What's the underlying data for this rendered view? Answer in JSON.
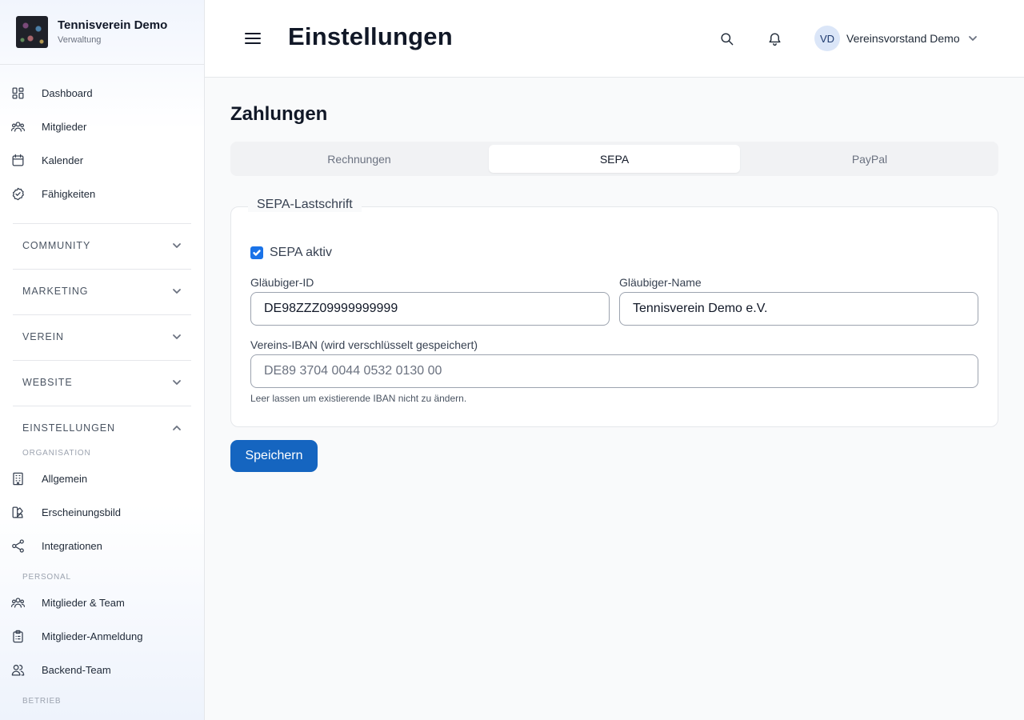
{
  "brand": {
    "name": "Tennisverein Demo",
    "subtitle": "Verwaltung"
  },
  "sidebar": {
    "main_items": [
      {
        "label": "Dashboard",
        "icon": "dashboard-icon"
      },
      {
        "label": "Mitglieder",
        "icon": "users-icon"
      },
      {
        "label": "Kalender",
        "icon": "calendar-icon"
      },
      {
        "label": "Fähigkeiten",
        "icon": "badge-check-icon"
      }
    ],
    "sections": [
      {
        "label": "COMMUNITY",
        "expanded": false
      },
      {
        "label": "MARKETING",
        "expanded": false
      },
      {
        "label": "VEREIN",
        "expanded": false
      },
      {
        "label": "WEBSITE",
        "expanded": false
      },
      {
        "label": "EINSTELLUNGEN",
        "expanded": true
      }
    ],
    "settings_groups": {
      "organisation": {
        "heading": "ORGANISATION",
        "items": [
          {
            "label": "Allgemein",
            "icon": "building-icon"
          },
          {
            "label": "Erscheinungsbild",
            "icon": "palette-icon"
          },
          {
            "label": "Integrationen",
            "icon": "share-icon"
          }
        ]
      },
      "personal": {
        "heading": "PERSONAL",
        "items": [
          {
            "label": "Mitglieder & Team",
            "icon": "users-icon"
          },
          {
            "label": "Mitglieder-Anmeldung",
            "icon": "clipboard-icon"
          },
          {
            "label": "Backend-Team",
            "icon": "team-icon"
          }
        ]
      },
      "betrieb": {
        "heading": "BETRIEB"
      }
    }
  },
  "header": {
    "title": "Einstellungen",
    "user": {
      "initials": "VD",
      "name": "Vereinsvorstand Demo"
    }
  },
  "main": {
    "section_title": "Zahlungen",
    "tabs": [
      {
        "label": "Rechnungen",
        "active": false
      },
      {
        "label": "SEPA",
        "active": true
      },
      {
        "label": "PayPal",
        "active": false
      }
    ],
    "sepa": {
      "legend": "SEPA-Lastschrift",
      "active_label": "SEPA aktiv",
      "active_checked": true,
      "creditor_id_label": "Gläubiger-ID",
      "creditor_id_value": "DE98ZZZ09999999999",
      "creditor_name_label": "Gläubiger-Name",
      "creditor_name_value": "Tennisverein Demo e.V.",
      "iban_label": "Vereins-IBAN (wird verschlüsselt gespeichert)",
      "iban_placeholder": "DE89 3704 0044 0532 0130 00",
      "iban_hint": "Leer lassen um existierende IBAN nicht zu ändern."
    },
    "save_label": "Speichern"
  },
  "colors": {
    "primary": "#1565c0",
    "checkbox": "#1a73e8",
    "avatar_bg": "#dbe6f8"
  }
}
